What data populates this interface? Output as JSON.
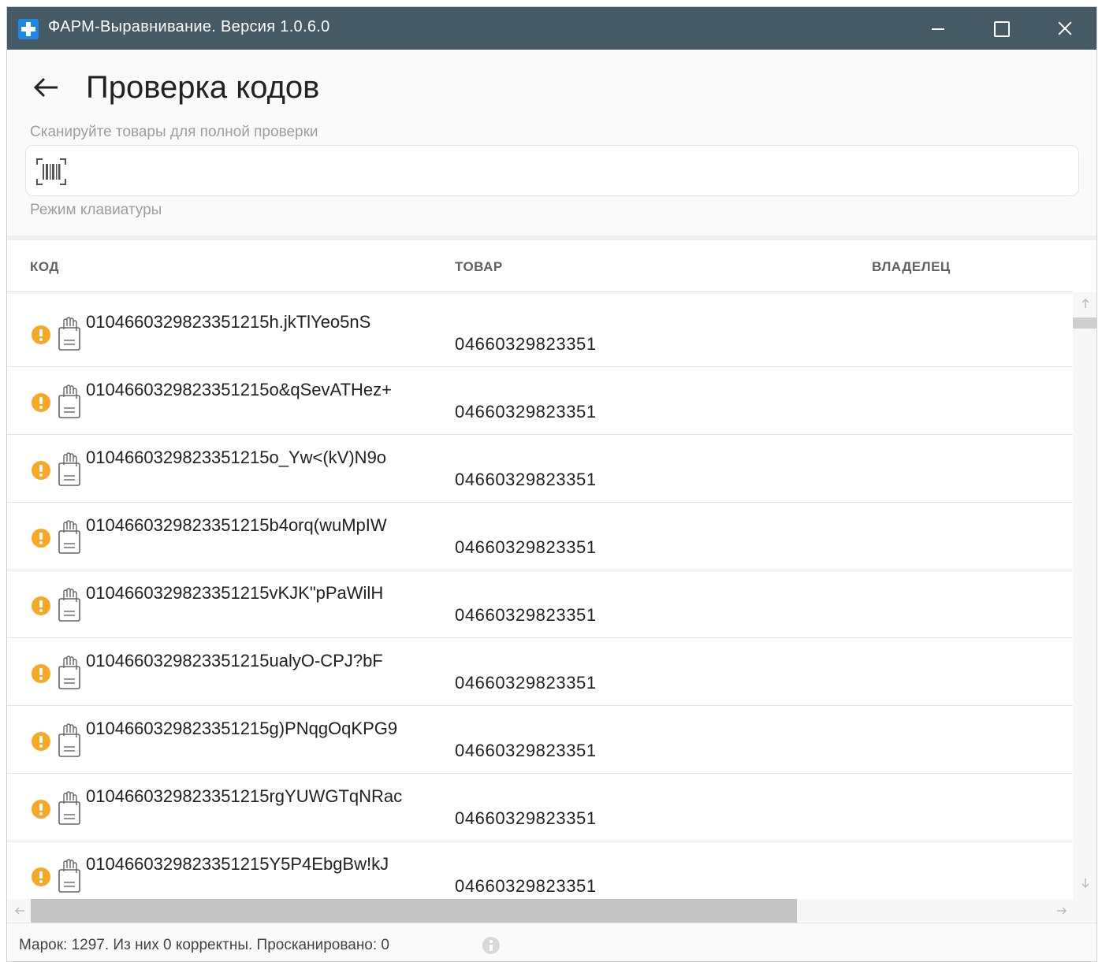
{
  "window": {
    "title": "ФАРМ-Выравнивание. Версия 1.0.6.0"
  },
  "header": {
    "title": "Проверка кодов",
    "scan_hint": "Сканируйте товары для полной проверки",
    "scan_input_value": "",
    "keyboard_mode": "Режим клавиатуры"
  },
  "table": {
    "columns": [
      "КОД",
      "ТОВАР",
      "ВЛАДЕЛЕЦ"
    ],
    "rows": [
      {
        "status": "warning",
        "code": "010466032982335121​5h.jkTlYeo5nS",
        "product": "04660329823351",
        "owner": ""
      },
      {
        "status": "warning",
        "code": "0104660329823351215o&qSevATHez+",
        "product": "04660329823351",
        "owner": ""
      },
      {
        "status": "warning",
        "code": "0104660329823351215o_Yw<(kV)N9o",
        "product": "04660329823351",
        "owner": ""
      },
      {
        "status": "warning",
        "code": "0104660329823351215b4orq(wuMpIW",
        "product": "04660329823351",
        "owner": ""
      },
      {
        "status": "warning",
        "code": "0104660329823351215vKJK\"pPaWilH",
        "product": "04660329823351",
        "owner": ""
      },
      {
        "status": "warning",
        "code": "0104660329823351215ualyO-CPJ?bF",
        "product": "04660329823351",
        "owner": ""
      },
      {
        "status": "warning",
        "code": "0104660329823351215g)PNqgOqKPG9",
        "product": "04660329823351",
        "owner": ""
      },
      {
        "status": "warning",
        "code": "0104660329823351215rgYUWGTqNRac",
        "product": "04660329823351",
        "owner": ""
      },
      {
        "status": "warning",
        "code": "0104660329823351215Y5P4EbgBw!kJ",
        "product": "04660329823351",
        "owner": ""
      }
    ]
  },
  "status_bar": {
    "text": "Марок: 1297. Из них 0 корректны. Просканировано: 0"
  },
  "colors": {
    "titlebar": "#455a64",
    "warning": "#f9a825",
    "app_icon": "#1e88e5"
  },
  "icons": {
    "row_status": "warning-icon",
    "row_type": "scanner-icon",
    "scan_field": "barcode-icon"
  }
}
